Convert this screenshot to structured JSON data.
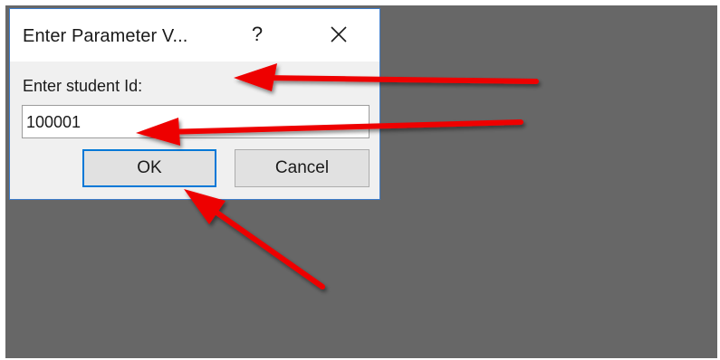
{
  "dialog": {
    "title": "Enter Parameter V...",
    "help_label": "?",
    "prompt_label": "Enter student Id:",
    "input_value": "100001",
    "ok_label": "OK",
    "cancel_label": "Cancel"
  },
  "colors": {
    "backdrop": "#676767",
    "dialog_bg": "#f0f0f0",
    "dialog_border": "#3d7cc9",
    "default_button_border": "#0078d7",
    "annotation_arrow": "#ee0000"
  },
  "icons": {
    "close": "close-icon",
    "help": "help-icon"
  },
  "annotations": [
    {
      "name": "arrow-to-label",
      "target": "prompt-label"
    },
    {
      "name": "arrow-to-input",
      "target": "parameter-value-input"
    },
    {
      "name": "arrow-to-ok",
      "target": "ok-button"
    }
  ]
}
